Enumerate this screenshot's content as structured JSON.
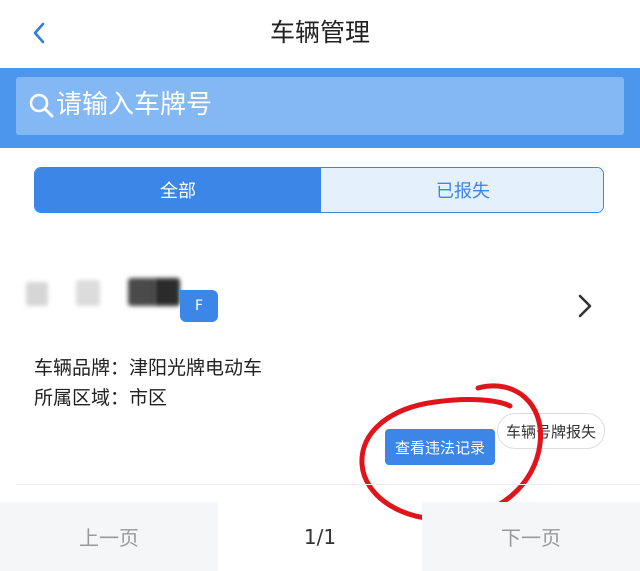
{
  "header": {
    "title": "车辆管理",
    "back_icon": "chevron-left-icon"
  },
  "search": {
    "placeholder": "请输入车牌号",
    "icon": "search-icon"
  },
  "tabs": [
    {
      "label": "全部",
      "selected": true
    },
    {
      "label": "已报失",
      "selected": false
    }
  ],
  "vehicle": {
    "plate_badge": "F",
    "brand_label": "车辆品牌：",
    "brand_value": "津阳光牌电动车",
    "region_label": "所属区域：",
    "region_value": "市区",
    "view_violations_button": "查看违法记录",
    "report_lost_button": "车辆号牌报失"
  },
  "pager": {
    "prev": "上一页",
    "page": "1/1",
    "next": "下一页"
  },
  "colors": {
    "accent": "#3b86e6",
    "search_band": "#4c96ee",
    "annotation_ring": "#e0141b"
  }
}
